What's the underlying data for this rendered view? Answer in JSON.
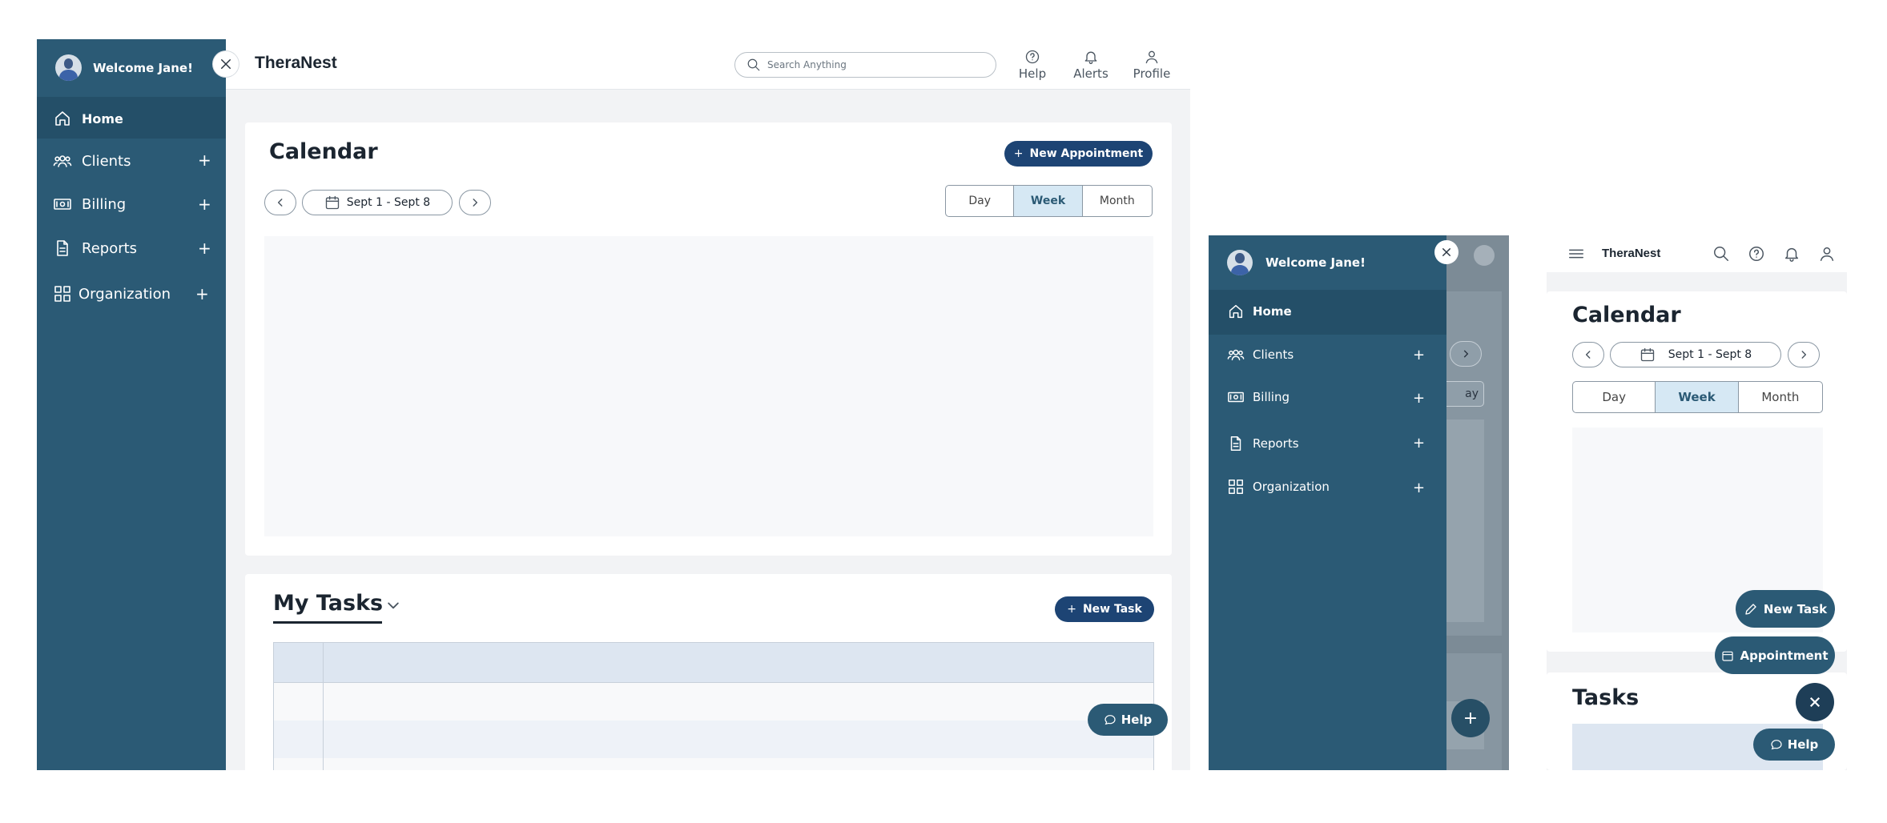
{
  "app": {
    "brand": "TheraNest"
  },
  "header": {
    "search_placeholder": "Search Anything",
    "help_label": "Help",
    "alerts_label": "Alerts",
    "profile_label": "Profile"
  },
  "sidebar": {
    "welcome": "Welcome Jane!",
    "items": [
      {
        "label": "Home",
        "icon": "home-icon"
      },
      {
        "label": "Clients",
        "icon": "clients-icon"
      },
      {
        "label": "Billing",
        "icon": "billing-icon"
      },
      {
        "label": "Reports",
        "icon": "reports-icon"
      },
      {
        "label": "Organization",
        "icon": "organization-icon"
      }
    ],
    "expand_symbol": "+"
  },
  "calendar": {
    "title": "Calendar",
    "new_appointment": "New Appointment",
    "date_range": "Sept 1 - Sept 8",
    "views": [
      "Day",
      "Week",
      "Month"
    ],
    "selected_view": "Week",
    "partial_view_label": "ay"
  },
  "tasks": {
    "title": "My Tasks",
    "mobile_title": "Tasks",
    "new_task": "New Task"
  },
  "mobile": {
    "new_task": "New Task",
    "appointment": "Appointment"
  },
  "help_button": "Help",
  "colors": {
    "sidebar": "#2b5a75",
    "sidebar_active": "#244f68",
    "primary_button": "#1d4474",
    "selected_tab": "#d6e8f4",
    "page_bg": "#f2f3f5"
  }
}
